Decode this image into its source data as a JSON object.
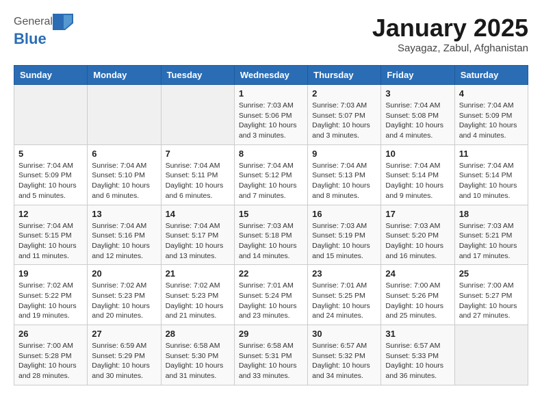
{
  "header": {
    "logo": {
      "general": "General",
      "blue": "Blue"
    },
    "title": "January 2025",
    "subtitle": "Sayagaz, Zabul, Afghanistan"
  },
  "weekdays": [
    "Sunday",
    "Monday",
    "Tuesday",
    "Wednesday",
    "Thursday",
    "Friday",
    "Saturday"
  ],
  "weeks": [
    [
      {
        "day": "",
        "sunrise": "",
        "sunset": "",
        "daylight": "",
        "empty": true
      },
      {
        "day": "",
        "sunrise": "",
        "sunset": "",
        "daylight": "",
        "empty": true
      },
      {
        "day": "",
        "sunrise": "",
        "sunset": "",
        "daylight": "",
        "empty": true
      },
      {
        "day": "1",
        "sunrise": "Sunrise: 7:03 AM",
        "sunset": "Sunset: 5:06 PM",
        "daylight": "Daylight: 10 hours and 3 minutes."
      },
      {
        "day": "2",
        "sunrise": "Sunrise: 7:03 AM",
        "sunset": "Sunset: 5:07 PM",
        "daylight": "Daylight: 10 hours and 3 minutes."
      },
      {
        "day": "3",
        "sunrise": "Sunrise: 7:04 AM",
        "sunset": "Sunset: 5:08 PM",
        "daylight": "Daylight: 10 hours and 4 minutes."
      },
      {
        "day": "4",
        "sunrise": "Sunrise: 7:04 AM",
        "sunset": "Sunset: 5:09 PM",
        "daylight": "Daylight: 10 hours and 4 minutes."
      }
    ],
    [
      {
        "day": "5",
        "sunrise": "Sunrise: 7:04 AM",
        "sunset": "Sunset: 5:09 PM",
        "daylight": "Daylight: 10 hours and 5 minutes."
      },
      {
        "day": "6",
        "sunrise": "Sunrise: 7:04 AM",
        "sunset": "Sunset: 5:10 PM",
        "daylight": "Daylight: 10 hours and 6 minutes."
      },
      {
        "day": "7",
        "sunrise": "Sunrise: 7:04 AM",
        "sunset": "Sunset: 5:11 PM",
        "daylight": "Daylight: 10 hours and 6 minutes."
      },
      {
        "day": "8",
        "sunrise": "Sunrise: 7:04 AM",
        "sunset": "Sunset: 5:12 PM",
        "daylight": "Daylight: 10 hours and 7 minutes."
      },
      {
        "day": "9",
        "sunrise": "Sunrise: 7:04 AM",
        "sunset": "Sunset: 5:13 PM",
        "daylight": "Daylight: 10 hours and 8 minutes."
      },
      {
        "day": "10",
        "sunrise": "Sunrise: 7:04 AM",
        "sunset": "Sunset: 5:14 PM",
        "daylight": "Daylight: 10 hours and 9 minutes."
      },
      {
        "day": "11",
        "sunrise": "Sunrise: 7:04 AM",
        "sunset": "Sunset: 5:14 PM",
        "daylight": "Daylight: 10 hours and 10 minutes."
      }
    ],
    [
      {
        "day": "12",
        "sunrise": "Sunrise: 7:04 AM",
        "sunset": "Sunset: 5:15 PM",
        "daylight": "Daylight: 10 hours and 11 minutes."
      },
      {
        "day": "13",
        "sunrise": "Sunrise: 7:04 AM",
        "sunset": "Sunset: 5:16 PM",
        "daylight": "Daylight: 10 hours and 12 minutes."
      },
      {
        "day": "14",
        "sunrise": "Sunrise: 7:04 AM",
        "sunset": "Sunset: 5:17 PM",
        "daylight": "Daylight: 10 hours and 13 minutes."
      },
      {
        "day": "15",
        "sunrise": "Sunrise: 7:03 AM",
        "sunset": "Sunset: 5:18 PM",
        "daylight": "Daylight: 10 hours and 14 minutes."
      },
      {
        "day": "16",
        "sunrise": "Sunrise: 7:03 AM",
        "sunset": "Sunset: 5:19 PM",
        "daylight": "Daylight: 10 hours and 15 minutes."
      },
      {
        "day": "17",
        "sunrise": "Sunrise: 7:03 AM",
        "sunset": "Sunset: 5:20 PM",
        "daylight": "Daylight: 10 hours and 16 minutes."
      },
      {
        "day": "18",
        "sunrise": "Sunrise: 7:03 AM",
        "sunset": "Sunset: 5:21 PM",
        "daylight": "Daylight: 10 hours and 17 minutes."
      }
    ],
    [
      {
        "day": "19",
        "sunrise": "Sunrise: 7:02 AM",
        "sunset": "Sunset: 5:22 PM",
        "daylight": "Daylight: 10 hours and 19 minutes."
      },
      {
        "day": "20",
        "sunrise": "Sunrise: 7:02 AM",
        "sunset": "Sunset: 5:23 PM",
        "daylight": "Daylight: 10 hours and 20 minutes."
      },
      {
        "day": "21",
        "sunrise": "Sunrise: 7:02 AM",
        "sunset": "Sunset: 5:23 PM",
        "daylight": "Daylight: 10 hours and 21 minutes."
      },
      {
        "day": "22",
        "sunrise": "Sunrise: 7:01 AM",
        "sunset": "Sunset: 5:24 PM",
        "daylight": "Daylight: 10 hours and 23 minutes."
      },
      {
        "day": "23",
        "sunrise": "Sunrise: 7:01 AM",
        "sunset": "Sunset: 5:25 PM",
        "daylight": "Daylight: 10 hours and 24 minutes."
      },
      {
        "day": "24",
        "sunrise": "Sunrise: 7:00 AM",
        "sunset": "Sunset: 5:26 PM",
        "daylight": "Daylight: 10 hours and 25 minutes."
      },
      {
        "day": "25",
        "sunrise": "Sunrise: 7:00 AM",
        "sunset": "Sunset: 5:27 PM",
        "daylight": "Daylight: 10 hours and 27 minutes."
      }
    ],
    [
      {
        "day": "26",
        "sunrise": "Sunrise: 7:00 AM",
        "sunset": "Sunset: 5:28 PM",
        "daylight": "Daylight: 10 hours and 28 minutes."
      },
      {
        "day": "27",
        "sunrise": "Sunrise: 6:59 AM",
        "sunset": "Sunset: 5:29 PM",
        "daylight": "Daylight: 10 hours and 30 minutes."
      },
      {
        "day": "28",
        "sunrise": "Sunrise: 6:58 AM",
        "sunset": "Sunset: 5:30 PM",
        "daylight": "Daylight: 10 hours and 31 minutes."
      },
      {
        "day": "29",
        "sunrise": "Sunrise: 6:58 AM",
        "sunset": "Sunset: 5:31 PM",
        "daylight": "Daylight: 10 hours and 33 minutes."
      },
      {
        "day": "30",
        "sunrise": "Sunrise: 6:57 AM",
        "sunset": "Sunset: 5:32 PM",
        "daylight": "Daylight: 10 hours and 34 minutes."
      },
      {
        "day": "31",
        "sunrise": "Sunrise: 6:57 AM",
        "sunset": "Sunset: 5:33 PM",
        "daylight": "Daylight: 10 hours and 36 minutes."
      },
      {
        "day": "",
        "sunrise": "",
        "sunset": "",
        "daylight": "",
        "empty": true
      }
    ]
  ]
}
